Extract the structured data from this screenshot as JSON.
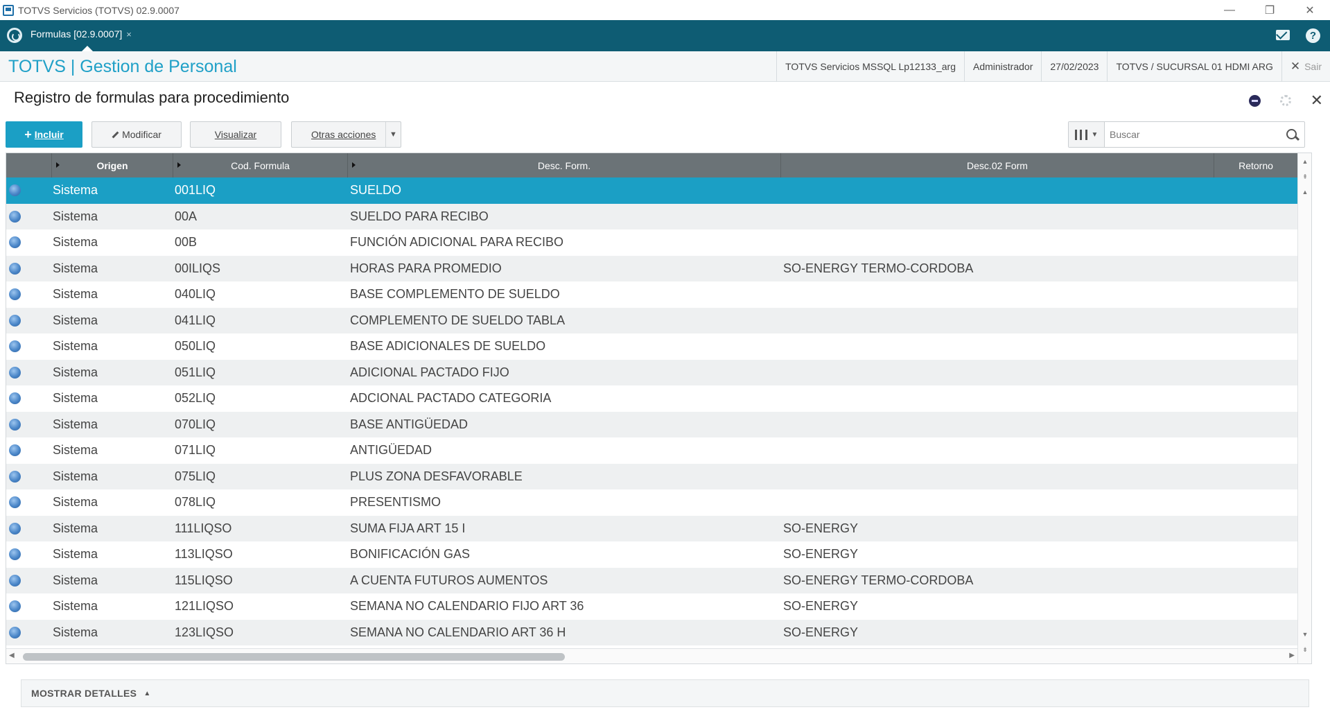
{
  "window": {
    "title": "TOTVS Servicios (TOTVS) 02.9.0007",
    "controls": [
      "—",
      "❐",
      "✕"
    ]
  },
  "tabbar": {
    "tab_label": "Formulas [02.9.0007]",
    "tab_close": "×"
  },
  "header": {
    "module_title": "TOTVS | Gestion de Personal",
    "environment": "TOTVS Servicios MSSQL Lp12133_arg",
    "user": "Administrador",
    "date": "27/02/2023",
    "branch": "TOTVS / SUCURSAL 01 HDMI ARG",
    "exit_label": "Sair"
  },
  "page": {
    "title": "Registro de formulas para procedimiento"
  },
  "toolbar": {
    "incluir_label": "Incluir",
    "modificar_label": "Modificar",
    "visualizar_label": "Visualizar",
    "otras_label": "Otras acciones",
    "search_placeholder": "Buscar"
  },
  "grid": {
    "columns": [
      "Origen",
      "Cod. Formula",
      "Desc. Form.",
      "Desc.02 Form",
      "Retorno"
    ],
    "rows": [
      {
        "origen": "Sistema",
        "cod": "001LIQ",
        "desc": "SUELDO",
        "desc2": ""
      },
      {
        "origen": "Sistema",
        "cod": "00A",
        "desc": "SUELDO PARA RECIBO",
        "desc2": ""
      },
      {
        "origen": "Sistema",
        "cod": "00B",
        "desc": "FUNCIÓN ADICIONAL PARA RECIBO",
        "desc2": ""
      },
      {
        "origen": "Sistema",
        "cod": "00ILIQS",
        "desc": "HORAS PARA PROMEDIO",
        "desc2": "SO-ENERGY TERMO-CORDOBA"
      },
      {
        "origen": "Sistema",
        "cod": "040LIQ",
        "desc": "BASE COMPLEMENTO DE SUELDO",
        "desc2": ""
      },
      {
        "origen": "Sistema",
        "cod": "041LIQ",
        "desc": "COMPLEMENTO DE SUELDO TABLA",
        "desc2": ""
      },
      {
        "origen": "Sistema",
        "cod": "050LIQ",
        "desc": "BASE ADICIONALES DE SUELDO",
        "desc2": ""
      },
      {
        "origen": "Sistema",
        "cod": "051LIQ",
        "desc": "ADICIONAL PACTADO FIJO",
        "desc2": ""
      },
      {
        "origen": "Sistema",
        "cod": "052LIQ",
        "desc": "ADCIONAL PACTADO CATEGORIA",
        "desc2": ""
      },
      {
        "origen": "Sistema",
        "cod": "070LIQ",
        "desc": "BASE ANTIGÜEDAD",
        "desc2": ""
      },
      {
        "origen": "Sistema",
        "cod": "071LIQ",
        "desc": "ANTIGÜEDAD",
        "desc2": ""
      },
      {
        "origen": "Sistema",
        "cod": "075LIQ",
        "desc": "PLUS ZONA DESFAVORABLE",
        "desc2": ""
      },
      {
        "origen": "Sistema",
        "cod": "078LIQ",
        "desc": "PRESENTISMO",
        "desc2": ""
      },
      {
        "origen": "Sistema",
        "cod": "111LIQSO",
        "desc": "SUMA FIJA ART 15 I",
        "desc2": "SO-ENERGY"
      },
      {
        "origen": "Sistema",
        "cod": "113LIQSO",
        "desc": "BONIFICACIÓN GAS",
        "desc2": "SO-ENERGY"
      },
      {
        "origen": "Sistema",
        "cod": "115LIQSO",
        "desc": "A CUENTA FUTUROS AUMENTOS",
        "desc2": "SO-ENERGY TERMO-CORDOBA"
      },
      {
        "origen": "Sistema",
        "cod": "121LIQSO",
        "desc": "SEMANA NO CALENDARIO FIJO ART 36",
        "desc2": "SO-ENERGY"
      },
      {
        "origen": "Sistema",
        "cod": "123LIQSO",
        "desc": "SEMANA NO CALENDARIO ART 36 H",
        "desc2": "SO-ENERGY"
      }
    ],
    "selected_index": 0
  },
  "footer": {
    "details_label": "MOSTRAR DETALLES"
  },
  "colors": {
    "tabbar": "#0e5c73",
    "accent": "#1b9fc5",
    "grid_header": "#6b7377"
  }
}
